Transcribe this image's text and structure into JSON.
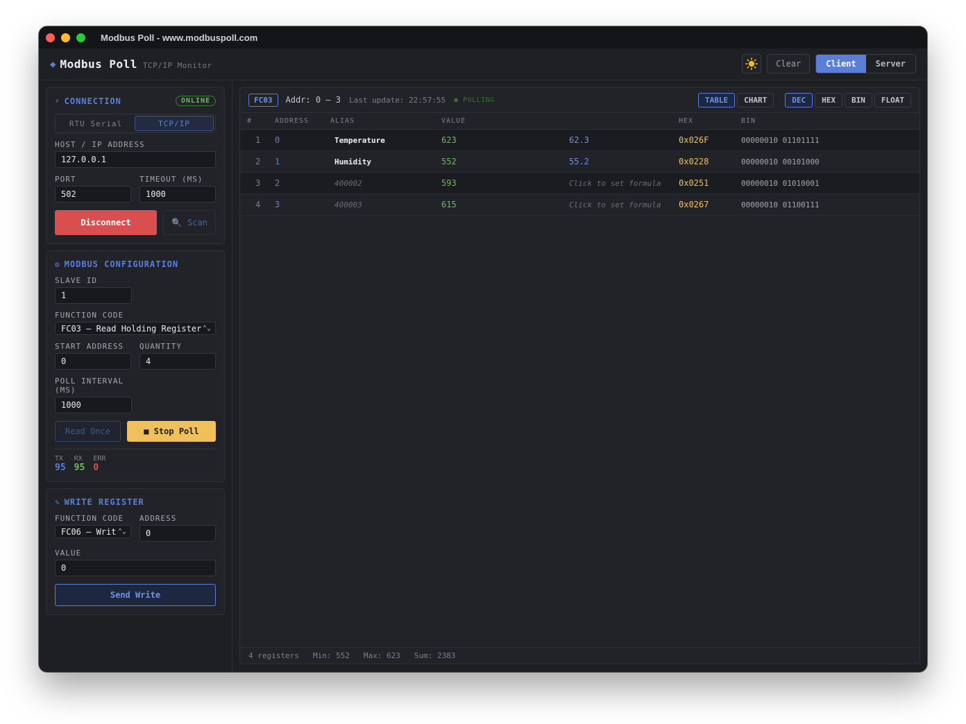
{
  "window": {
    "title": "Modbus Poll - www.modbuspoll.com"
  },
  "header": {
    "brand": "Modbus Poll",
    "subtitle": "TCP/IP Monitor",
    "clear_label": "Clear",
    "client_label": "Client",
    "server_label": "Server"
  },
  "connection": {
    "title": "CONNECTION",
    "status": "ONLINE",
    "mode_rtu": "RTU Serial",
    "mode_tcp": "TCP/IP",
    "host_label": "HOST / IP ADDRESS",
    "host_value": "127.0.0.1",
    "port_label": "PORT",
    "port_value": "502",
    "timeout_label": "TIMEOUT (MS)",
    "timeout_value": "1000",
    "disconnect_label": "Disconnect",
    "scan_label": "Scan"
  },
  "modbus_config": {
    "title": "MODBUS CONFIGURATION",
    "slave_label": "SLAVE ID",
    "slave_value": "1",
    "function_label": "FUNCTION CODE",
    "function_value": "FC03 — Read Holding Register",
    "start_label": "START ADDRESS",
    "start_value": "0",
    "quantity_label": "QUANTITY",
    "quantity_value": "4",
    "interval_label_1": "POLL INTERVAL",
    "interval_label_2": "(MS)",
    "interval_value": "1000",
    "read_once_label": "Read Once",
    "stop_poll_label": "■ Stop Poll",
    "tx_label": "TX",
    "tx_value": "95",
    "rx_label": "RX",
    "rx_value": "95",
    "err_label": "ERR",
    "err_value": "0"
  },
  "write_register": {
    "title": "WRITE REGISTER",
    "function_label": "FUNCTION CODE",
    "function_value": "FC06 — Writ",
    "address_label": "ADDRESS",
    "address_value": "0",
    "value_label": "VALUE",
    "value_value": "0",
    "send_label": "Send Write"
  },
  "toolbar": {
    "fc_badge": "FC03",
    "addr_range": "Addr: 0 — 3",
    "last_update": "Last update: 22:57:55",
    "polling": "● POLLING",
    "view_table": "TABLE",
    "view_chart": "CHART",
    "fmt_dec": "DEC",
    "fmt_hex": "HEX",
    "fmt_bin": "BIN",
    "fmt_float": "FLOAT"
  },
  "table": {
    "headers": {
      "num": "#",
      "address": "ADDRESS",
      "alias": "ALIAS",
      "value": "VALUE",
      "hex": "HEX",
      "bin": "BIN"
    },
    "rows": [
      {
        "num": "1",
        "address": "0",
        "alias": "Temperature",
        "value": "623",
        "formula": "62.3",
        "hex": "0x026F",
        "bin": "00000010 01101111"
      },
      {
        "num": "2",
        "address": "1",
        "alias": "Humidity",
        "value": "552",
        "formula": "55.2",
        "hex": "0x0228",
        "bin": "00000010 00101000"
      },
      {
        "num": "3",
        "address": "2",
        "alias": "400002",
        "value": "593",
        "formula": "Click to set formula",
        "hex": "0x0251",
        "bin": "00000010 01010001"
      },
      {
        "num": "4",
        "address": "3",
        "alias": "400003",
        "value": "615",
        "formula": "Click to set formula",
        "hex": "0x0267",
        "bin": "00000010 01100111"
      }
    ]
  },
  "footer": {
    "count": "4 registers",
    "min": "Min: 552",
    "max": "Max: 623",
    "sum": "Sum: 2383"
  },
  "colors": {
    "accent": "#5b7fd8",
    "success": "#6dbb5e",
    "danger": "#d94f4f",
    "warning": "#f0c05a"
  }
}
